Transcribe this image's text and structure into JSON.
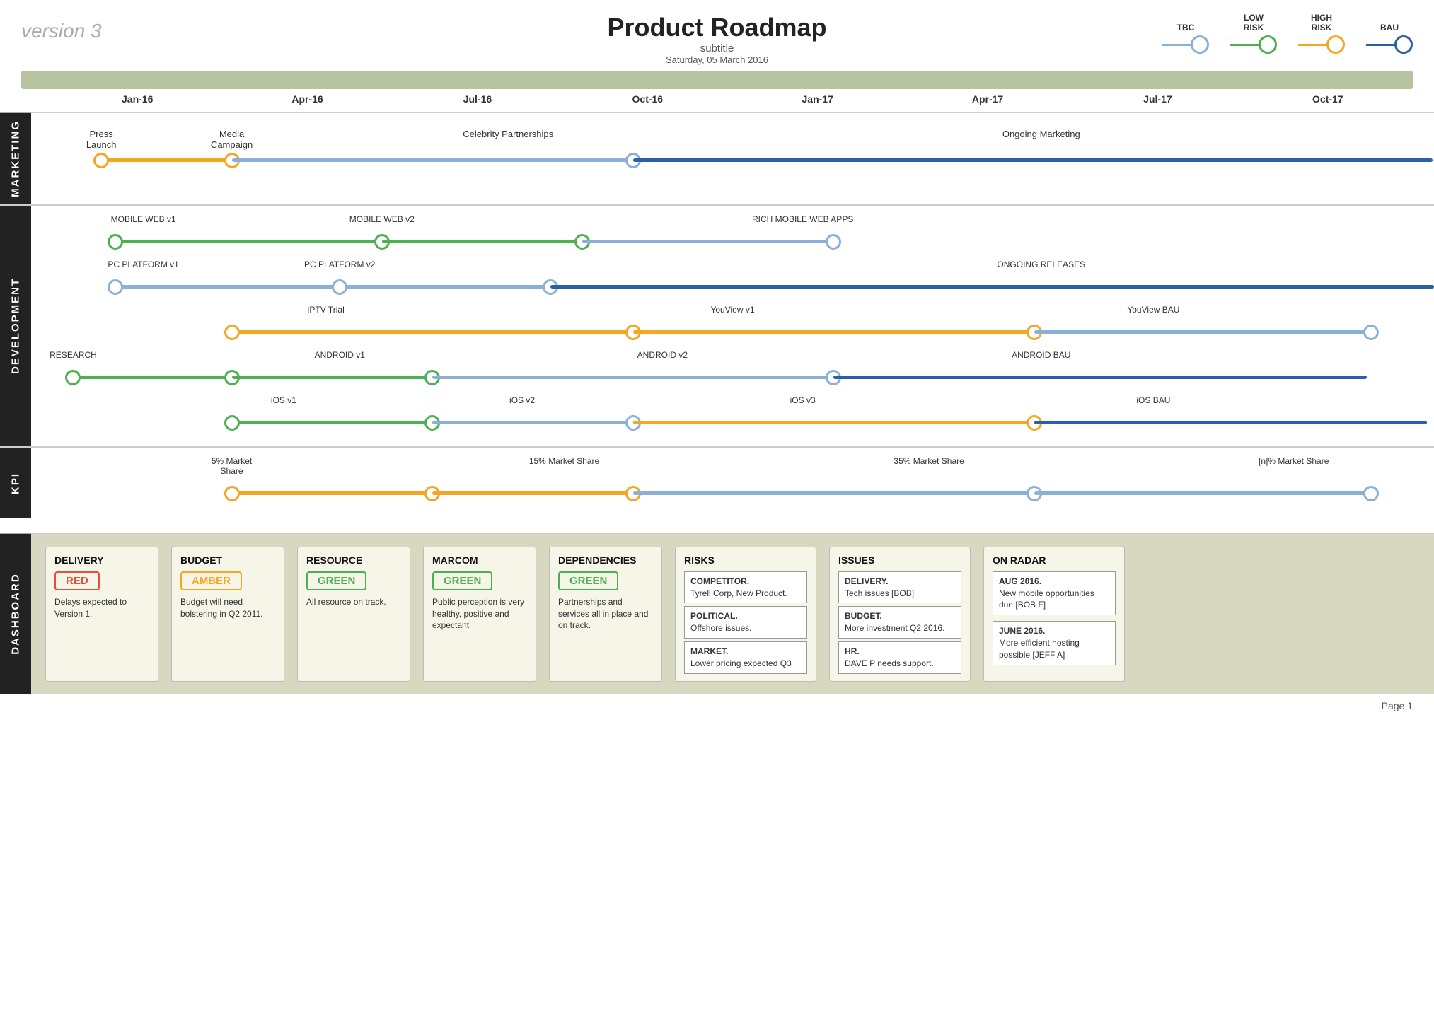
{
  "header": {
    "version": "version 3",
    "title": "Product Roadmap",
    "subtitle": "subtitle",
    "date": "Saturday, 05 March 2016"
  },
  "legend": {
    "items": [
      {
        "label": "TBC",
        "color": "#8ab0d8",
        "line_color": "#8ab0d8"
      },
      {
        "label": "LOW\nRISK",
        "color": "#4CAF50",
        "line_color": "#4CAF50"
      },
      {
        "label": "HIGH\nRISK",
        "color": "#f5a623",
        "line_color": "#f5a623"
      },
      {
        "label": "BAU",
        "color": "#2c5fa8",
        "line_color": "#2c5fa8"
      }
    ]
  },
  "timeline": {
    "months": [
      "Jan-16",
      "Apr-16",
      "Jul-16",
      "Oct-16",
      "Jan-17",
      "Apr-17",
      "Jul-17",
      "Oct-17"
    ]
  },
  "sections": {
    "marketing": {
      "label": "MARKETING",
      "tracks": [
        {
          "label_start": "Press\nLaunch",
          "label_mid1": "Media\nCampaign",
          "label_mid2": "Celebrity Partnerships",
          "label_end": "Ongoing Marketing"
        }
      ]
    },
    "development": {
      "label": "DEVELOPMENT",
      "tracks": [
        {
          "name": "mobile_web",
          "label1": "MOBILE WEB v1",
          "label2": "MOBILE WEB v2",
          "label3": "RICH MOBILE WEB APPS"
        },
        {
          "name": "pc_platform",
          "label1": "PC PLATFORM v1",
          "label2": "PC PLATFORM v2",
          "label3": "ONGOING RELEASES"
        },
        {
          "name": "iptv",
          "label1": "IPTV Trial",
          "label2": "YouView v1",
          "label3": "YouView BAU"
        },
        {
          "name": "android",
          "label0": "RESEARCH",
          "label1": "ANDROID v1",
          "label2": "ANDROID v2",
          "label3": "ANDROID BAU"
        },
        {
          "name": "ios",
          "label1": "iOS v1",
          "label2": "iOS v2",
          "label3": "iOS v3",
          "label4": "iOS BAU"
        }
      ]
    },
    "kpi": {
      "label": "KPI",
      "tracks": [
        {
          "label1": "5% Market\nShare",
          "label2": "15% Market Share",
          "label3": "35% Market Share",
          "label4": "[n]% Market Share"
        }
      ]
    }
  },
  "dashboard": {
    "label": "DASHBOARD",
    "cards": [
      {
        "title": "DELIVERY",
        "status": "RED",
        "status_color": "#e74c3c",
        "text": "Delays expected to Version 1."
      },
      {
        "title": "BUDGET",
        "status": "AMBER",
        "status_color": "#f5a623",
        "text": "Budget will need bolstering in Q2 2011."
      },
      {
        "title": "RESOURCE",
        "status": "GREEN",
        "status_color": "#4CAF50",
        "text": "All resource on track."
      },
      {
        "title": "MARCOM",
        "status": "GREEN",
        "status_color": "#4CAF50",
        "text": "Public perception is very healthy, positive and expectant"
      },
      {
        "title": "DEPENDENCIES",
        "status": "GREEN",
        "status_color": "#4CAF50",
        "text": "Partnerships and services all in place and on track."
      }
    ],
    "risks": {
      "title": "RISKS",
      "items": [
        {
          "label": "COMPETITOR.",
          "text": "Tyrell Corp, New Product."
        },
        {
          "label": "POLITICAL.",
          "text": "Offshore issues."
        },
        {
          "label": "MARKET.",
          "text": "Lower pricing expected Q3"
        }
      ]
    },
    "issues": {
      "title": "ISSUES",
      "items": [
        {
          "label": "DELIVERY.",
          "text": "Tech issues [BOB]"
        },
        {
          "label": "BUDGET.",
          "text": "More investment Q2 2016."
        },
        {
          "label": "HR.",
          "text": "DAVE P needs support."
        }
      ]
    },
    "on_radar": {
      "title": "ON RADAR",
      "items": [
        {
          "label": "AUG 2016.",
          "text": "New mobile opportunities due [BOB F]"
        },
        {
          "label": "JUNE 2016.",
          "text": "More efficient hosting possible [JEFF A]"
        }
      ]
    }
  },
  "page": {
    "number": "Page 1"
  }
}
